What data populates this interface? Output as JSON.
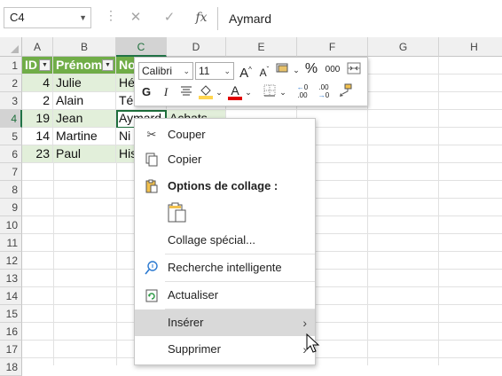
{
  "formula_bar": {
    "name_box": "C4",
    "cancel_glyph": "✕",
    "enter_glyph": "✓",
    "fx_label": "fx",
    "content": "Aymard"
  },
  "columns": [
    "A",
    "B",
    "C",
    "D",
    "E",
    "F",
    "G",
    "H"
  ],
  "rows": [
    "1",
    "2",
    "3",
    "4",
    "5",
    "6",
    "7",
    "8",
    "9",
    "10",
    "11",
    "12",
    "13",
    "14",
    "15",
    "16",
    "17",
    "18"
  ],
  "selected_cell": "C4",
  "table": {
    "headers": [
      "ID",
      "Prénom",
      "No"
    ],
    "rows": [
      {
        "id": "4",
        "prenom": "Julie",
        "nom": "Hé",
        "d": ""
      },
      {
        "id": "2",
        "prenom": "Alain",
        "nom": "Té",
        "d": ""
      },
      {
        "id": "19",
        "prenom": "Jean",
        "nom": "Aymard",
        "d": "Achats"
      },
      {
        "id": "14",
        "prenom": "Martine",
        "nom": "Ni",
        "d": ""
      },
      {
        "id": "23",
        "prenom": "Paul",
        "nom": "His",
        "d": ""
      }
    ]
  },
  "mini_toolbar": {
    "font_name": "Calibri",
    "font_size": "11",
    "grow_font": "A",
    "shrink_font": "A",
    "percent": "%",
    "thousands": "000",
    "bold": "G",
    "italic": "I",
    "text_color_letter": "A",
    "fill_color": "#ffd54f",
    "font_color": "#e00000"
  },
  "context_menu": {
    "cut": "Couper",
    "copy": "Copier",
    "paste_options_title": "Options de collage :",
    "paste_special": "Collage spécial...",
    "smart_lookup": "Recherche intelligente",
    "refresh": "Actualiser",
    "insert": "Insérer",
    "delete": "Supprimer"
  },
  "colors": {
    "header_green": "#70ad47",
    "band_green": "#e2efda",
    "accent": "#217346",
    "menu_highlight": "#d9d9d9"
  }
}
